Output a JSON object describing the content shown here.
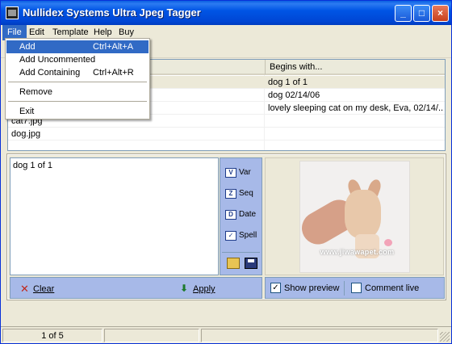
{
  "window": {
    "title": "Nullidex Systems Ultra Jpeg Tagger",
    "controls": {
      "minimize": "_",
      "maximize": "□",
      "close": "×"
    }
  },
  "menubar": {
    "items": [
      {
        "label": "File"
      },
      {
        "label": "Edit"
      },
      {
        "label": "Template"
      },
      {
        "label": "Help"
      },
      {
        "label": "Buy"
      }
    ]
  },
  "file_menu": {
    "items": [
      {
        "label": "Add",
        "shortcut": "Ctrl+Alt+A"
      },
      {
        "label": "Add Uncommented",
        "shortcut": ""
      },
      {
        "label": "Add Containing",
        "shortcut": "Ctrl+Alt+R"
      },
      {
        "label": "Remove",
        "shortcut": ""
      },
      {
        "label": "Exit",
        "shortcut": ""
      }
    ]
  },
  "file_list": {
    "columns": [
      "",
      "Begins with..."
    ],
    "rows": [
      {
        "name": "",
        "begins": "dog 1 of 1"
      },
      {
        "name": "",
        "begins": "dog 02/14/06"
      },
      {
        "name": "",
        "begins": "lovely sleeping cat on my desk, Eva, 02/14/..."
      },
      {
        "name": "cat7.jpg",
        "begins": ""
      },
      {
        "name": "dog.jpg",
        "begins": ""
      }
    ]
  },
  "editor": {
    "text": "dog 1 of 1"
  },
  "sidebar": {
    "buttons": [
      {
        "label": "Var",
        "icon": "var-icon",
        "glyph": "V"
      },
      {
        "label": "Seq",
        "icon": "seq-icon",
        "glyph": "Z"
      },
      {
        "label": "Date",
        "icon": "date-icon",
        "glyph": "D"
      },
      {
        "label": "Spell",
        "icon": "spell-icon",
        "glyph": "✓"
      }
    ]
  },
  "preview": {
    "watermark": "www.jiwawapet.com"
  },
  "actions": {
    "clear": "Clear",
    "apply": "Apply"
  },
  "options": {
    "show_preview": {
      "label": "Show preview",
      "checked": true
    },
    "comment_live": {
      "label": "Comment live",
      "checked": false
    }
  },
  "status": {
    "position": "1 of 5"
  },
  "colors": {
    "titlebar": "#0055e5",
    "menu_highlight": "#316ac5",
    "panel": "#a7b9e8"
  }
}
